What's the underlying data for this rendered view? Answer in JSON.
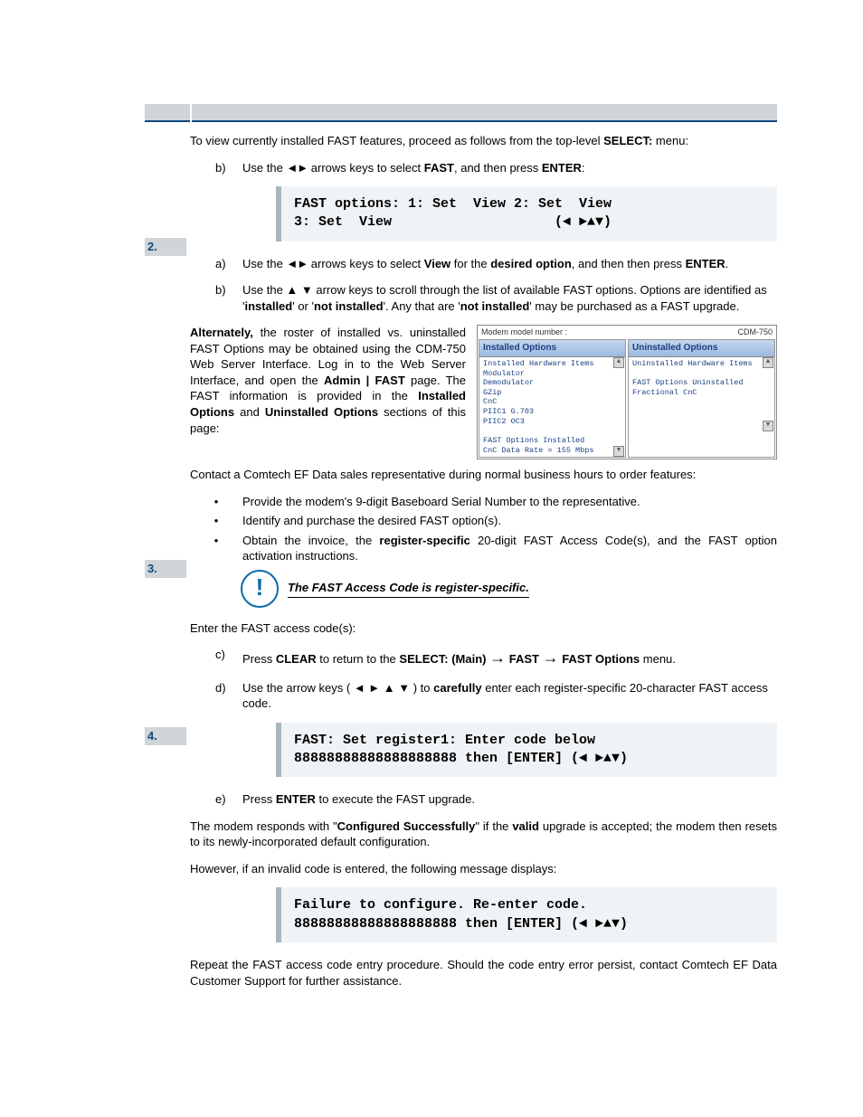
{
  "step2": {
    "num": "2.",
    "intro_a": "To view currently installed FAST features, proceed as follows from the top-level ",
    "intro_b": "SELECT:",
    "intro_c": " menu:",
    "b": {
      "marker": "b)",
      "t1": "Use the ",
      "t2": " arrows keys to select ",
      "t3": "FAST",
      "t4": ", and then press ",
      "t5": "ENTER",
      "t6": ":"
    },
    "lcd1_l1": "FAST options: 1: Set  View 2: Set  View",
    "lcd1_l2": "3: Set  View                    (◄ ►▲▼)",
    "a2": {
      "marker": "a)",
      "t1": "Use the ",
      "t2": " arrows keys to select ",
      "t3": "View",
      "t4": " for the ",
      "t5": "desired option",
      "t6": ", and then then press ",
      "t7": "ENTER",
      "t8": "."
    },
    "b2": {
      "marker": "b)",
      "t1": "Use the ▲ ▼ arrow keys to scroll through the list of available FAST options. Options are identified as '",
      "t2": "installed",
      "t3": "' or '",
      "t4": "not installed",
      "t5": "'. Any that are '",
      "t6": "not installed",
      "t7": "' may be purchased as a FAST upgrade."
    },
    "alt": {
      "t1": "Alternately, ",
      "t2": "the roster of installed vs. uninstalled FAST Options may be obtained using the CDM-750 Web Server Interface. Log in to the Web Server Interface, and open the ",
      "t3": "Admin | FAST",
      "t4": " page. The FAST information is provided in the ",
      "t5": "Installed Options",
      "t6": " and ",
      "t7": "Uninstalled Options",
      "t8": " sections of this page:"
    },
    "screenshot": {
      "topbar_l": "Modem model number :",
      "topbar_r": "CDM-750",
      "col1_head": "Installed Options",
      "col1_body": "Installed Hardware Items\nModulator\nDemodulator\nGZip\nCnC\nPIIC1 G.703\nPIIC2 OC3\n\nFAST Options Installed\nCnC Data Rate = 155 Mbps",
      "col2_head": "Uninstalled Options",
      "col2_body": "Uninstalled Hardware Items\n\nFAST Options Uninstalled\nFractional CnC"
    }
  },
  "step3": {
    "num": "3.",
    "intro": "Contact a Comtech EF Data sales representative during normal business hours to order features:",
    "li1": "Provide the modem's 9-digit Baseboard Serial Number to the representative.",
    "li2": "Identify and purchase the desired FAST option(s).",
    "li3a": "Obtain the invoice, the ",
    "li3b": "register-specific",
    "li3c": " 20-digit FAST Access Code(s), and the FAST option activation instructions.",
    "note": "The FAST Access Code is register-specific."
  },
  "step4": {
    "num": "4.",
    "intro": "Enter the FAST access code(s):",
    "c": {
      "marker": "c)",
      "t1": "Press ",
      "t2": "CLEAR",
      "t3": " to return to the ",
      "t4": "SELECT: (Main)",
      "t5": "FAST",
      "t6": "FAST Options",
      "t7": " menu."
    },
    "d": {
      "marker": "d)",
      "t1": "Use the arrow keys ( ◄ ► ▲ ▼ ) to ",
      "t2": "carefully",
      "t3": " enter each register-specific  20-character FAST access code."
    },
    "lcd2_l1": "FAST: Set register1: Enter code below",
    "lcd2_l2": "88888888888888888888 then [ENTER] (◄ ►▲▼)",
    "e": {
      "marker": "e)",
      "t1": "Press ",
      "t2": "ENTER",
      "t3": " to execute the FAST upgrade."
    },
    "resp1a": "The modem responds with \"",
    "resp1b": "Configured Successfully",
    "resp1c": "\" if the ",
    "resp1d": "valid",
    "resp1e": " upgrade is accepted; the modem then resets to its newly-incorporated default configuration.",
    "resp2": "However, if an invalid code is entered, the following message displays:",
    "lcd3_l1": "Failure to configure. Re-enter code.",
    "lcd3_l2": "88888888888888888888 then [ENTER] (◄ ►▲▼)",
    "outro": "Repeat the FAST access code entry procedure. Should the code entry error persist, contact Comtech EF Data Customer Support for further assistance."
  }
}
